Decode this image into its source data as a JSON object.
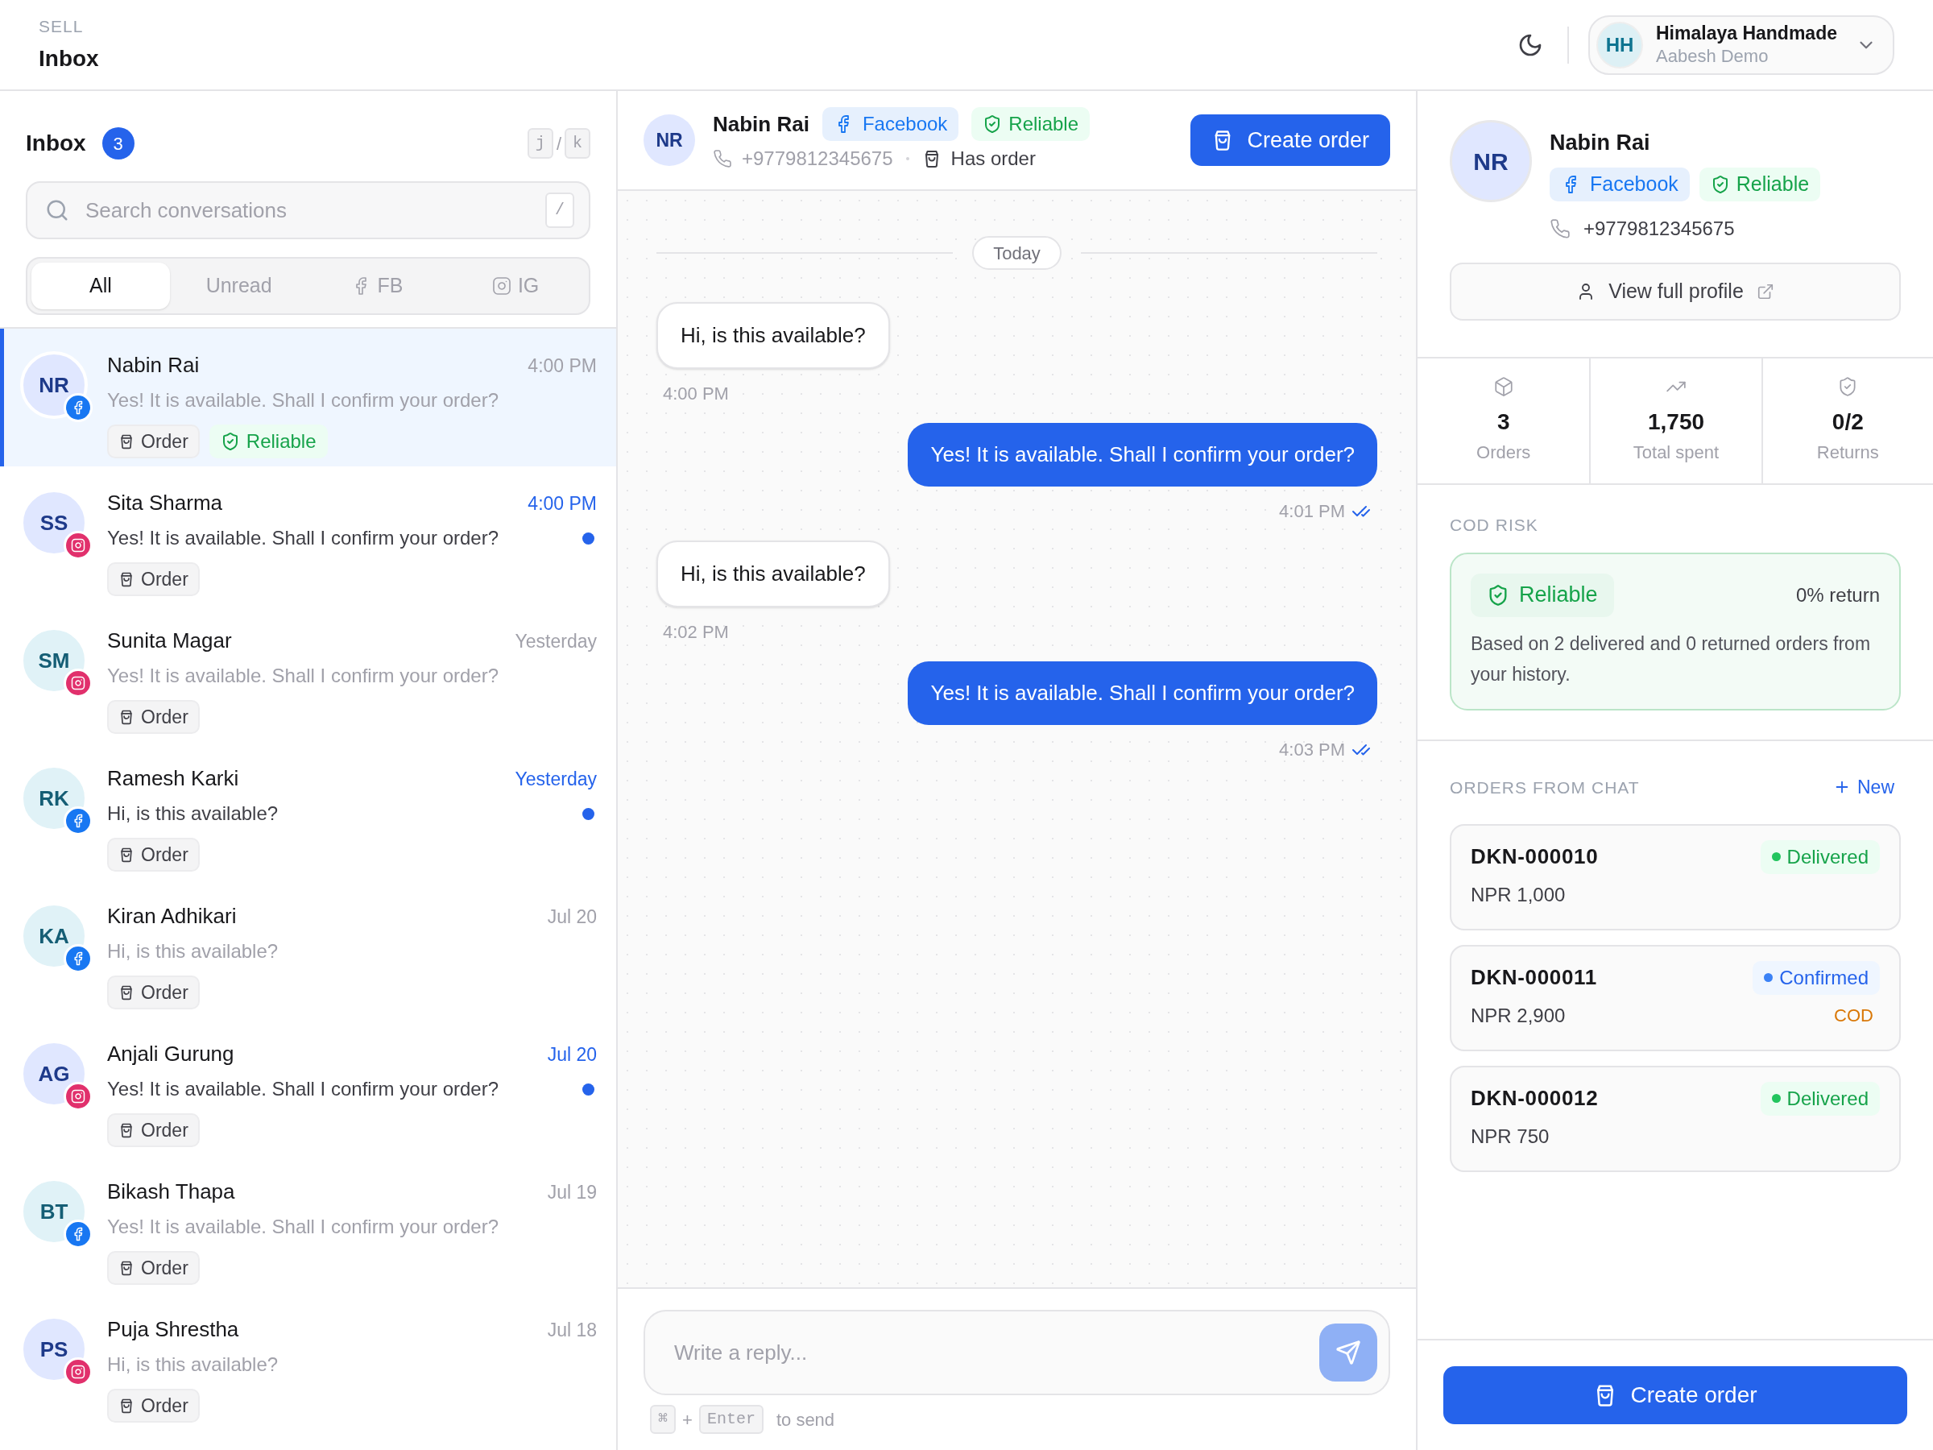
{
  "header": {
    "section": "SELL",
    "title": "Inbox"
  },
  "account": {
    "initials": "HH",
    "name": "Himalaya Handmade",
    "subtitle": "Aabesh Demo"
  },
  "inbox": {
    "title": "Inbox",
    "count": "3",
    "nav_keys": [
      "j",
      "k"
    ],
    "nav_separator": "/",
    "search": {
      "placeholder": "Search conversations",
      "shortcut": "/"
    },
    "filters": [
      {
        "label": "All",
        "kind": "all",
        "selected": true
      },
      {
        "label": "Unread",
        "kind": "unread",
        "selected": false
      },
      {
        "label": "FB",
        "kind": "facebook",
        "selected": false
      },
      {
        "label": "IG",
        "kind": "instagram",
        "selected": false
      }
    ],
    "conversations": [
      {
        "initials": "NR",
        "color": "#e0e7ff",
        "kind": "facebook",
        "name": "Nabin Rai",
        "time": "4:00 PM",
        "preview": "Yes! It is available. Shall I confirm your order?",
        "unread": false,
        "selected": true,
        "tags": [
          {
            "kind": "order",
            "label": "Order"
          },
          {
            "kind": "reliable",
            "label": "Reliable"
          }
        ]
      },
      {
        "initials": "SS",
        "color": "#e0e7ff",
        "kind": "instagram",
        "name": "Sita Sharma",
        "time": "4:00 PM",
        "preview": "Yes! It is available. Shall I confirm your order?",
        "unread": true,
        "selected": false,
        "tags": [
          {
            "kind": "order",
            "label": "Order"
          }
        ]
      },
      {
        "initials": "SM",
        "color": "#e0f2f7",
        "kind": "instagram",
        "name": "Sunita Magar",
        "time": "Yesterday",
        "preview": "Yes! It is available. Shall I confirm your order?",
        "unread": false,
        "selected": false,
        "tags": [
          {
            "kind": "order",
            "label": "Order"
          }
        ]
      },
      {
        "initials": "RK",
        "color": "#e0f2f7",
        "kind": "facebook",
        "name": "Ramesh Karki",
        "time": "Yesterday",
        "preview": "Hi, is this available?",
        "unread": true,
        "selected": false,
        "tags": [
          {
            "kind": "order",
            "label": "Order"
          }
        ]
      },
      {
        "initials": "KA",
        "color": "#e0f2f7",
        "kind": "facebook",
        "name": "Kiran Adhikari",
        "time": "Jul 20",
        "preview": "Hi, is this available?",
        "unread": false,
        "selected": false,
        "tags": [
          {
            "kind": "order",
            "label": "Order"
          }
        ]
      },
      {
        "initials": "AG",
        "color": "#e0e7ff",
        "kind": "instagram",
        "name": "Anjali Gurung",
        "time": "Jul 20",
        "preview": "Yes! It is available. Shall I confirm your order?",
        "unread": true,
        "selected": false,
        "tags": [
          {
            "kind": "order",
            "label": "Order"
          }
        ]
      },
      {
        "initials": "BT",
        "color": "#e0f2f7",
        "kind": "facebook",
        "name": "Bikash Thapa",
        "time": "Jul 19",
        "preview": "Yes! It is available. Shall I confirm your order?",
        "unread": false,
        "selected": false,
        "tags": [
          {
            "kind": "order",
            "label": "Order"
          }
        ]
      },
      {
        "initials": "PS",
        "color": "#e0e7ff",
        "kind": "instagram",
        "name": "Puja Shrestha",
        "time": "Jul 18",
        "preview": "Hi, is this available?",
        "unread": false,
        "selected": false,
        "tags": [
          {
            "kind": "order",
            "label": "Order"
          }
        ]
      }
    ]
  },
  "chat": {
    "contact": {
      "initials": "NR",
      "name": "Nabin Rai",
      "channel_badge": "Facebook",
      "risk_badge": "Reliable",
      "phone": "+9779812345675",
      "order_status": "Has order"
    },
    "create_button": "Create order",
    "date_divider": "Today",
    "messages": [
      {
        "kind": "in",
        "text": "Hi, is this available?",
        "time": "4:00 PM"
      },
      {
        "kind": "out",
        "text": "Yes! It is available. Shall I confirm your order?",
        "time": "4:01 PM",
        "read": true
      },
      {
        "kind": "in",
        "text": "Hi, is this available?",
        "time": "4:02 PM"
      },
      {
        "kind": "out",
        "text": "Yes! It is available. Shall I confirm your order?",
        "time": "4:03 PM",
        "read": true
      }
    ],
    "composer": {
      "placeholder": "Write a reply...",
      "hint_keys": [
        "⌘",
        "Enter"
      ],
      "hint_plus": "+",
      "hint_text": "to send"
    }
  },
  "profile": {
    "initials": "NR",
    "name": "Nabin Rai",
    "channel_badge": "Facebook",
    "risk_badge": "Reliable",
    "phone": "+9779812345675",
    "view_button": "View full profile",
    "stats": [
      {
        "kind": "orders",
        "value": "3",
        "label": "Orders"
      },
      {
        "kind": "spent",
        "value": "1,750",
        "label": "Total spent"
      },
      {
        "kind": "returns",
        "value": "0/2",
        "label": "Returns"
      }
    ],
    "cod_risk": {
      "heading": "COD RISK",
      "badge": "Reliable",
      "return_rate": "0% return",
      "note": "Based on 2 delivered and 0 returned orders from your history."
    },
    "orders_heading": "ORDERS FROM CHAT",
    "new_link": "New",
    "orders": [
      {
        "id": "DKN-000010",
        "status": "Delivered",
        "kind": "delivered",
        "amount": "NPR 1,000"
      },
      {
        "id": "DKN-000011",
        "status": "Confirmed",
        "kind": "confirmed",
        "amount": "NPR 2,900",
        "payment": "COD"
      },
      {
        "id": "DKN-000012",
        "status": "Delivered",
        "kind": "delivered",
        "amount": "NPR 750"
      }
    ],
    "create_button": "Create order"
  }
}
